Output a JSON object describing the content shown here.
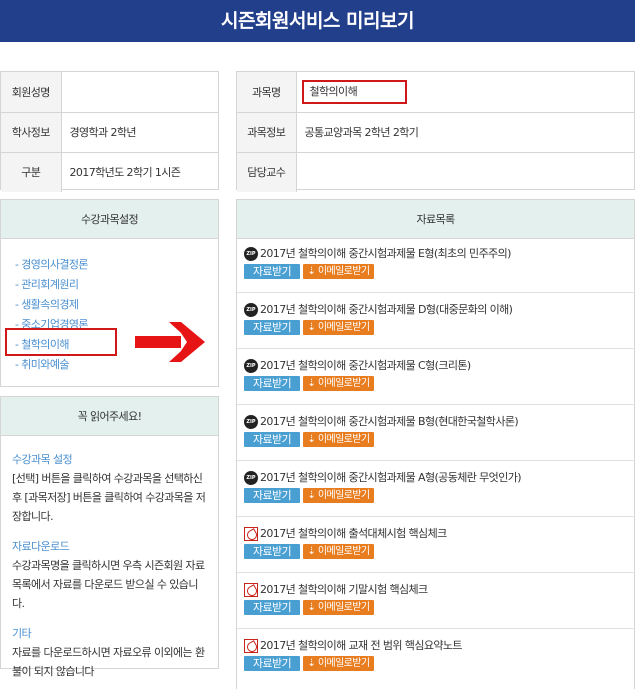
{
  "header": {
    "title": "시즌회원서비스 미리보기"
  },
  "member_info": {
    "rows": [
      {
        "label": "회원성명",
        "value": ""
      },
      {
        "label": "학사정보",
        "value": "경영학과 2학년"
      },
      {
        "label": "구분",
        "value": "2017학년도 2학기 1시즌"
      }
    ]
  },
  "subject_info": {
    "rows": [
      {
        "label": "과목명",
        "value": "철학의이해"
      },
      {
        "label": "과목정보",
        "value": "공통교양과목 2학년 2학기"
      },
      {
        "label": "담당교수",
        "value": ""
      }
    ]
  },
  "course_settings": {
    "title": "수강과목설정",
    "items": [
      "- 경영의사결정론",
      "- 관리회계원리",
      "- 생활속의경제",
      "- 중소기업경영론",
      "- 철학의이해",
      "- 취미와예술"
    ],
    "selected": "- 철학의이해"
  },
  "notice": {
    "title": "꼭 읽어주세요!",
    "sections": [
      {
        "title": "수강과목 설정",
        "text": "[선택] 버튼을 클릭하여 수강과목을 선택하신 후 [과목저장] 버튼을 클릭하여 수강과목을 저장합니다."
      },
      {
        "title": "자료다운로드",
        "text": "수강과목명을 클릭하시면 우측 시즌회원 자료 목록에서 자료를 다운로드 받으실 수 있습니다."
      },
      {
        "title": "기타",
        "text": "자료를 다운로드하시면 자료오류 이외에는 환불이 되지 않습니다"
      }
    ]
  },
  "materials": {
    "title": "자료목록",
    "download_label": "자료받기",
    "email_label": "⇣ 이메일로받기",
    "items": [
      {
        "type": "zip",
        "title": "2017년 철학의이해 중간시험과제물 E형(최초의 민주주의)"
      },
      {
        "type": "zip",
        "title": "2017년 철학의이해 중간시험과제물 D형(대중문화의 이해)"
      },
      {
        "type": "zip",
        "title": "2017년 철학의이해 중간시험과제물 C형(크리톤)"
      },
      {
        "type": "zip",
        "title": "2017년 철학의이해 중간시험과제물 B형(현대한국철학사론)"
      },
      {
        "type": "zip",
        "title": "2017년 철학의이해 중간시험과제물 A형(공동체란 무엇인가)"
      },
      {
        "type": "pdf",
        "title": "2017년 철학의이해 출석대체시험 핵심체크"
      },
      {
        "type": "pdf",
        "title": "2017년 철학의이해 기말시험 핵심체크"
      },
      {
        "type": "pdf",
        "title": "2017년 철학의이해 교재 전 범위 핵심요약노트"
      }
    ]
  },
  "colors": {
    "header_bg": "#223f8c",
    "panel_head_bg": "#e3f0ed",
    "link": "#4a8fcf",
    "download_btn": "#4a9fd2",
    "email_btn": "#e87d1f",
    "highlight": "#d01818"
  }
}
